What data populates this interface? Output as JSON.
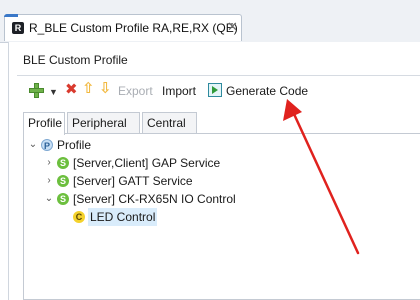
{
  "window": {
    "tab_icon_letter": "R",
    "tab_title": "R_BLE Custom Profile RA,RE,RX (QE)",
    "tab_close_glyph": "✕"
  },
  "editor": {
    "section_title": "BLE Custom Profile"
  },
  "toolbar": {
    "add_icon": "plus-icon",
    "dropdown_glyph": "▼",
    "delete_glyph": "✖",
    "up_glyph": "⇧",
    "down_glyph": "⇩",
    "export_label": "Export",
    "import_label": "Import",
    "generate_label": "Generate Code"
  },
  "tabs": [
    {
      "label": "Profile",
      "active": true
    },
    {
      "label": "Peripheral",
      "active": false
    },
    {
      "label": "Central",
      "active": false
    }
  ],
  "tree": [
    {
      "expander": "⌄",
      "icon": "P",
      "label": "Profile"
    },
    {
      "expander": "›",
      "icon": "S",
      "label": "[Server,Client] GAP Service"
    },
    {
      "expander": "›",
      "icon": "S",
      "label": "[Server] GATT Service"
    },
    {
      "expander": "⌄",
      "icon": "S",
      "label": "[Server] CK-RX65N IO Control"
    },
    {
      "expander": "",
      "icon": "C",
      "label": "LED Control",
      "selected": true
    }
  ],
  "colors": {
    "annotation_arrow": "#e0221e",
    "service_icon": "#6cbf3e",
    "characteristic_icon": "#f4d22c",
    "selection": "#d9ecfb"
  }
}
